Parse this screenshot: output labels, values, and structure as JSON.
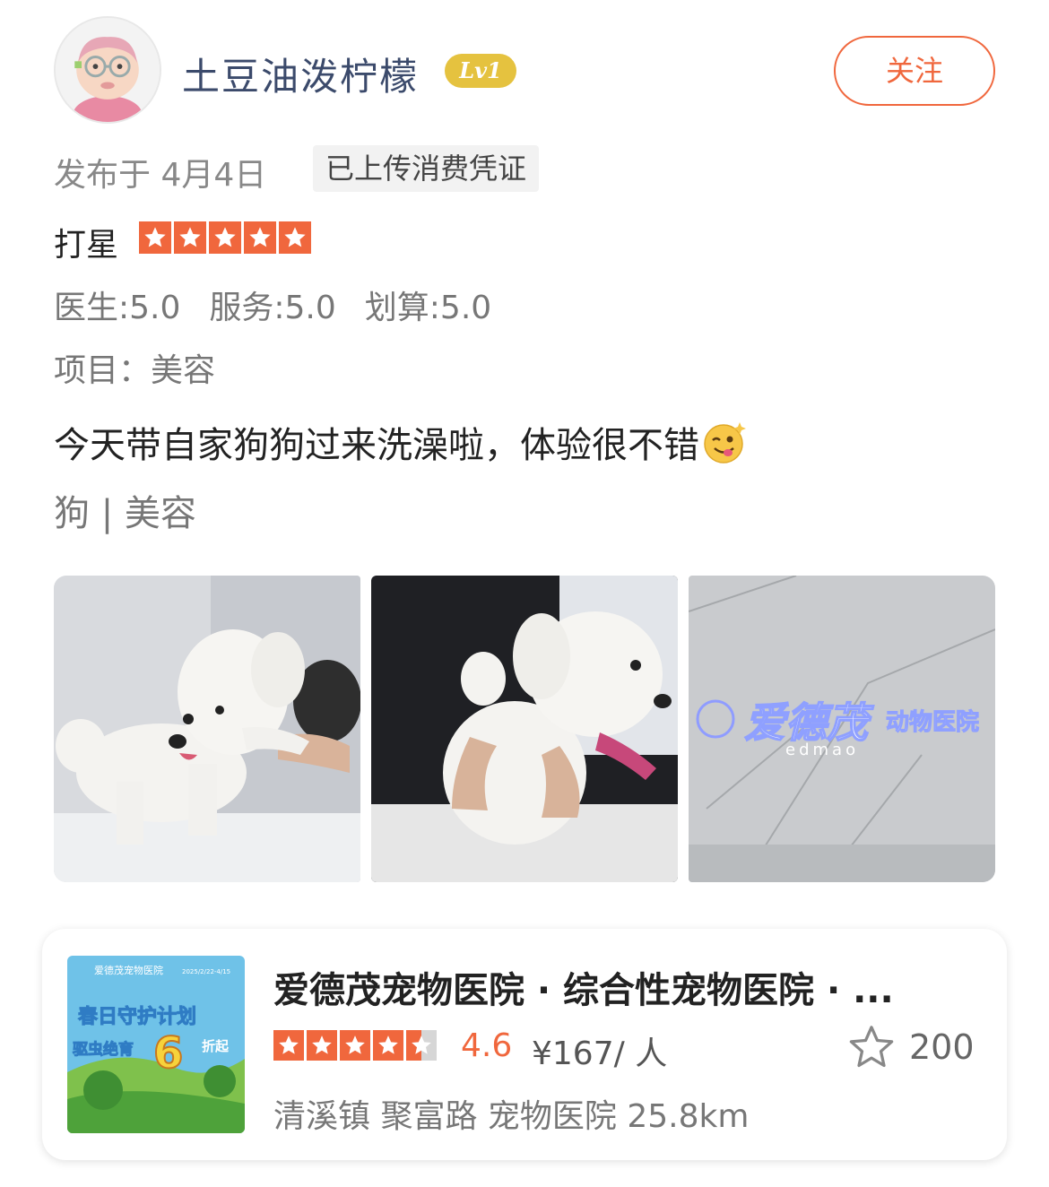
{
  "user": {
    "name": "土豆油泼柠檬",
    "level": "Lv1",
    "follow_label": "关注"
  },
  "post": {
    "published": "发布于 4月4日",
    "receipt_tag": "已上传消费凭证",
    "rating_label": "打星",
    "rating_stars": 5,
    "scores": [
      "医生:5.0",
      "服务:5.0",
      "划算:5.0"
    ],
    "project": "项目：美容",
    "text": "今天带自家狗狗过来洗澡啦，体验很不错",
    "tags": "狗 | 美容",
    "photo_sign_text": "爱德茂",
    "photo_sign_sub": "动物医院",
    "photo_sign_latin": "edmao"
  },
  "shop": {
    "name": "爱德茂宠物医院 · 综合性宠物医院 · ...",
    "stars": 4.5,
    "score": "4.6",
    "price": "¥167/ 人",
    "fav_count": "200",
    "location": "清溪镇 聚富路 宠物医院   25.8km",
    "thumb_title": "春日守护计划",
    "thumb_sub": "驱虫绝育",
    "thumb_num": "6",
    "thumb_suffix": "折起",
    "thumb_brand": "爱德茂宠物医院",
    "thumb_date": "2025/2/22-4/15"
  },
  "colors": {
    "accent": "#f0673d",
    "level_badge": "#e5c23f",
    "username": "#3b4a6b"
  }
}
